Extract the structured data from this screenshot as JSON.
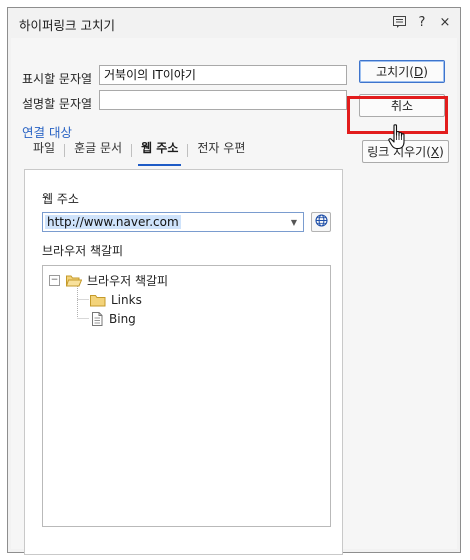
{
  "dialog": {
    "title": "하이퍼링크 고치기",
    "icons": [
      "memo-icon",
      "help-icon",
      "close-icon"
    ],
    "help_glyph": "?",
    "close_glyph": "×"
  },
  "fields": {
    "display_label": "표시할 문자열",
    "display_value": "거북이의 IT이야기",
    "desc_label": "설명할 문자열",
    "desc_value": ""
  },
  "link_target": {
    "section_title": "연결 대상",
    "tabs": [
      {
        "label": "파일",
        "active": false
      },
      {
        "label": "훈글 문서",
        "active": false
      },
      {
        "label": "웹 주소",
        "active": true
      },
      {
        "label": "전자 우편",
        "active": false
      }
    ]
  },
  "web_panel": {
    "url_label": "웹 주소",
    "url_value": "http://www.naver.com",
    "bookmarks_label": "브라우저 책갈피",
    "tree": {
      "root": "브라우저 책갈피",
      "root_toggle": "−",
      "children": [
        "Links",
        "Bing"
      ]
    }
  },
  "buttons": {
    "ok_prefix": "고치기(",
    "ok_key": "D",
    "ok_suffix": ")",
    "cancel": "취소",
    "unlink_prefix": "링크 지우기(",
    "unlink_key": "X",
    "unlink_suffix": ")"
  },
  "colors": {
    "accent": "#2a64c4",
    "highlight_box": "#e21c1c",
    "selection": "#cfe3fb"
  }
}
